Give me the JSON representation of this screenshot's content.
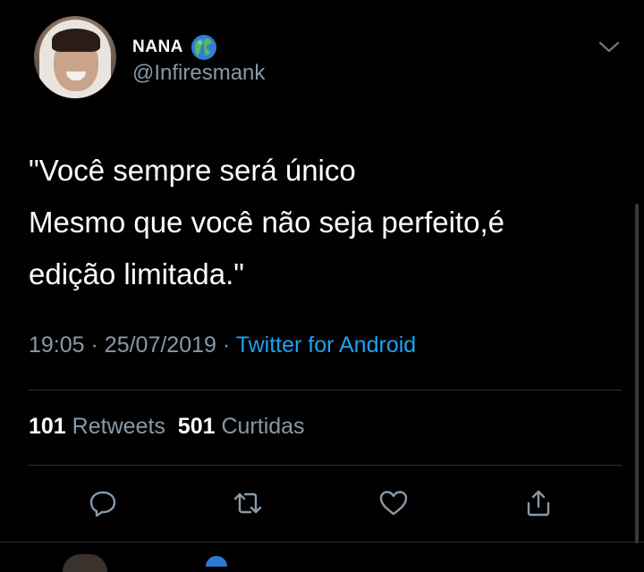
{
  "tweet": {
    "author_name": "NANA",
    "author_handle": "@Infiresmank",
    "text_lines": [
      "\"Você sempre será único",
      "Mesmo que você não seja perfeito,é",
      "edição limitada.\""
    ],
    "time": "19:05",
    "separator": "·",
    "date": "25/07/2019",
    "source": "Twitter for Android",
    "retweets_count": "101",
    "retweets_label": "Retweets",
    "likes_count": "501",
    "likes_label": "Curtidas"
  },
  "icons": {
    "globe": "globe-emoji-icon",
    "caret": "chevron-down-icon",
    "reply": "reply-icon",
    "retweet": "retweet-icon",
    "like": "heart-icon",
    "share": "share-icon"
  },
  "colors": {
    "background": "#000000",
    "primary_text": "#ffffff",
    "secondary_text": "#8899a6",
    "link": "#1da1f2",
    "divider": "#2f3336"
  }
}
